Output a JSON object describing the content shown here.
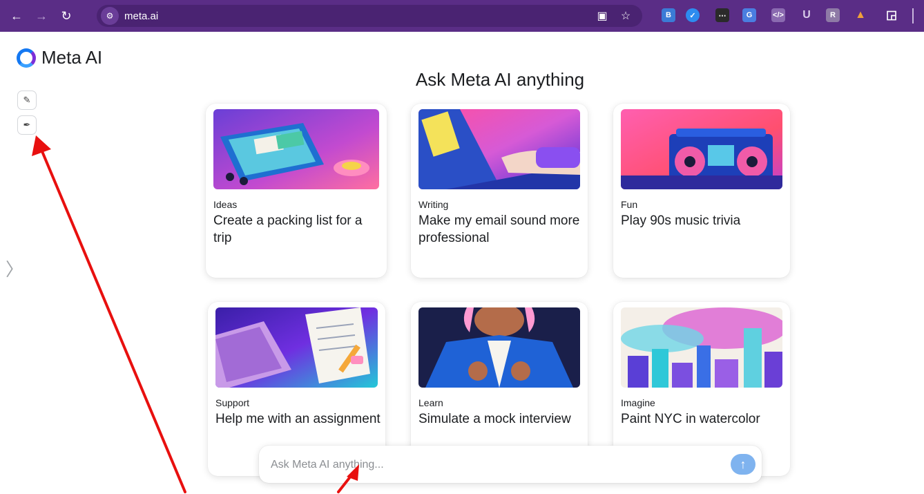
{
  "browser": {
    "url": "meta.ai",
    "icons": [
      "back-icon",
      "forward-icon",
      "reload-icon",
      "site-settings-icon",
      "install-app-icon",
      "bookmark-star-icon",
      "extensions-icon"
    ]
  },
  "sidebar": {
    "logo_text": "Meta AI",
    "buttons": [
      "new-chat-icon",
      "imagine-brush-icon"
    ],
    "expand_icon": "chevron-right-icon"
  },
  "main": {
    "heading": "Ask Meta AI anything",
    "cards": [
      {
        "category": "Ideas",
        "title": "Create a packing list for a trip"
      },
      {
        "category": "Writing",
        "title": "Make my email sound more professional"
      },
      {
        "category": "Fun",
        "title": "Play 90s music trivia"
      },
      {
        "category": "Support",
        "title": "Help me with an assignment"
      },
      {
        "category": "Learn",
        "title": "Simulate a mock interview"
      },
      {
        "category": "Imagine",
        "title": "Paint NYC in watercolor"
      }
    ]
  },
  "chat": {
    "placeholder": "Ask Meta AI anything...",
    "value": "",
    "send_icon": "arrow-up-icon"
  },
  "colors": {
    "browser_bar": "#5a2d86",
    "accent": "#1478f2",
    "send_button": "#7fb3ef",
    "annotation_arrow": "#e8100f"
  }
}
